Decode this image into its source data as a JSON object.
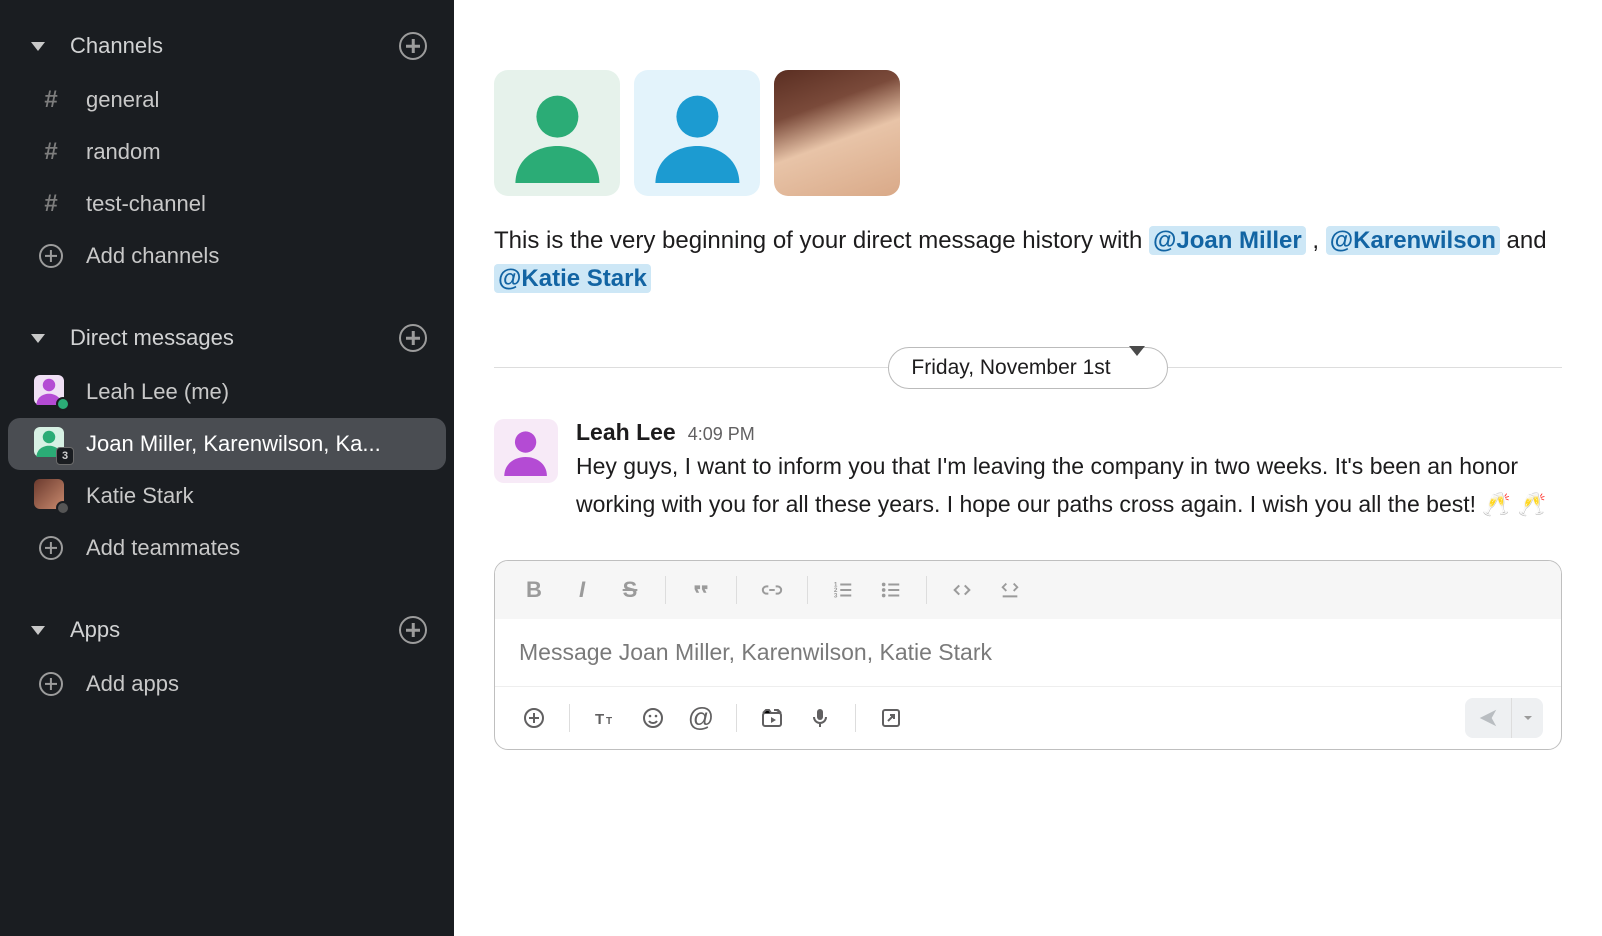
{
  "sidebar": {
    "sections": {
      "channels": {
        "title": "Channels"
      },
      "dms": {
        "title": "Direct messages"
      },
      "apps": {
        "title": "Apps"
      }
    },
    "channels": [
      {
        "name": "general"
      },
      {
        "name": "random"
      },
      {
        "name": "test-channel"
      }
    ],
    "add_channels": "Add channels",
    "dms": [
      {
        "label": "Leah Lee (me)",
        "color": "#b44bd4",
        "presence": "active"
      },
      {
        "label": "Joan Miller, Karenwilson, Ka...",
        "color": "#2bac76",
        "group_count": "3",
        "active": true
      },
      {
        "label": "Katie Stark",
        "photo": true,
        "presence": "away"
      }
    ],
    "add_teammates": "Add teammates",
    "add_apps": "Add apps"
  },
  "main": {
    "intro": {
      "prefix": "This is the very beginning of your direct message history with ",
      "m1": "@Joan Miller",
      "sep1": " , ",
      "m2": "@Karenwilson",
      "and": " and ",
      "m3": "@Katie Stark"
    },
    "date": "Friday, November 1st",
    "message": {
      "author": "Leah Lee",
      "time": "4:09 PM",
      "text": "Hey guys, I want to inform you that I'm leaving the company in two weeks. It's been an honor working with you for all these years. I hope our paths cross again. I wish you all the best! 🥂 🥂"
    },
    "composer": {
      "placeholder": "Message Joan Miller, Karenwilson, Katie Stark"
    }
  },
  "colors": {
    "green": "#2bac76",
    "blue": "#1c9bd1",
    "purple": "#b44bd4"
  }
}
